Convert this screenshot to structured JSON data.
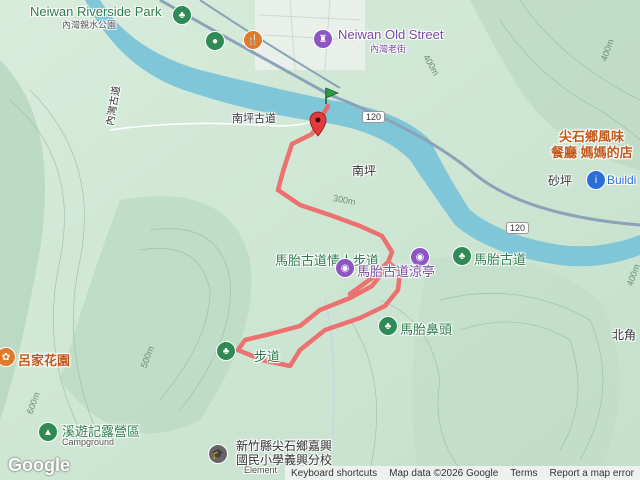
{
  "colors": {
    "river": "#79c3d6",
    "route": "#ef5a5a",
    "terrain_light": "#e5f2e6",
    "terrain_dark": "#b8d8c3"
  },
  "labels": {
    "riverside_park": "Neiwan Riverside Park",
    "riverside_park_zh": "內灣親水公園",
    "old_street": "Neiwan Old Street",
    "old_street_zh": "內灣老街",
    "nanping_trail": "南坪古道",
    "nanping": "南坪",
    "fengping_trail": "馬胎古道情人步道",
    "matai_trail": "馬胎古道",
    "matai_pavilion": "馬胎古道涼亭",
    "matai_nose": "馬胎鼻頭",
    "restaurant": "尖石鄉風味",
    "restaurant2": "餐廳 媽媽的店",
    "shaping": "砂坪",
    "building": "Buildi",
    "beijiao": "北角",
    "lujia_garden": "呂家花園",
    "xiyou": "溪遊記露營區",
    "campground": "Campground",
    "school_1": "新竹縣尖石鄉嘉興",
    "school_2": "國民小學義興分校",
    "school_3": "Element",
    "hiking_trail": "步道",
    "side_trail": "內灣古道"
  },
  "roads": {
    "r120a": "120",
    "r120b": "120"
  },
  "contours": {
    "c300": "300m",
    "c400a": "400m",
    "c400b": "400m",
    "c400c": "400m",
    "c500": "500m",
    "c600": "600m"
  },
  "footer": {
    "keyboard": "Keyboard shortcuts",
    "mapdata": "Map data ©2026 Google",
    "terms": "Terms",
    "report": "Report a map error"
  },
  "brand": "Google",
  "icons": [
    "park-icon",
    "attraction-icon",
    "restaurant-icon",
    "camera-icon",
    "school-icon",
    "info-icon",
    "start-flag-icon",
    "end-pin-icon"
  ]
}
